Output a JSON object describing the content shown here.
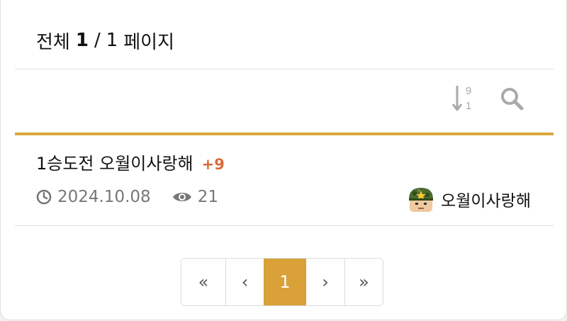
{
  "header": {
    "label": "전체",
    "current_page": "1",
    "separator": "/",
    "total_pages": "1",
    "unit": "페이지"
  },
  "toolbar": {
    "sort_icon": "sort-numeric-desc-icon",
    "search_icon": "search-icon"
  },
  "post": {
    "title": "1승도전 오월이사랑해",
    "comment_count": "+9",
    "date": "2024.10.08",
    "views": "21",
    "author": "오월이사랑해"
  },
  "pagination": {
    "first": "«",
    "prev": "‹",
    "current": "1",
    "next": "›",
    "last": "»"
  },
  "colors": {
    "accent": "#daa73d",
    "active_page": "#d9a137",
    "comment": "#d86a3a"
  }
}
